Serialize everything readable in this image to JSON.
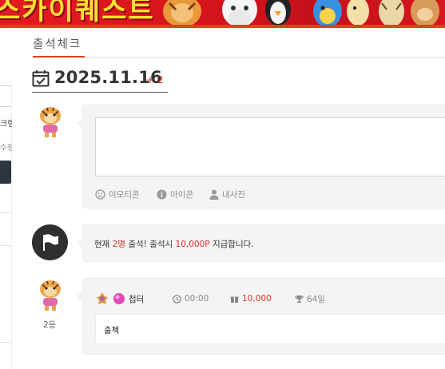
{
  "banner": {
    "logo_text": "스카이퀘스트"
  },
  "sidebar": {
    "fragment_1": "크램",
    "fragment_2": "수정"
  },
  "page": {
    "title": "출석체크"
  },
  "date": {
    "value": "2025.11.16",
    "offset": "+ 2"
  },
  "composer": {
    "placeholder": "",
    "tools": [
      {
        "label": "이모티콘",
        "icon": "smile-icon"
      },
      {
        "label": "아이콘",
        "icon": "info-icon"
      },
      {
        "label": "내사진",
        "icon": "user-icon"
      }
    ]
  },
  "notice": {
    "prefix": "현재 ",
    "count": "2명",
    "middle": " 출석! 출석시 ",
    "points": "10,000P",
    "suffix": " 지급합니다."
  },
  "entry": {
    "rank": "2등",
    "username": "첩터",
    "time": "00:00",
    "points": "10,000",
    "streak": "64일",
    "comment": "출첵"
  },
  "colors": {
    "accent": "#d8441a",
    "highlight": "#d0352b",
    "card_bg": "#f4f4f4"
  }
}
